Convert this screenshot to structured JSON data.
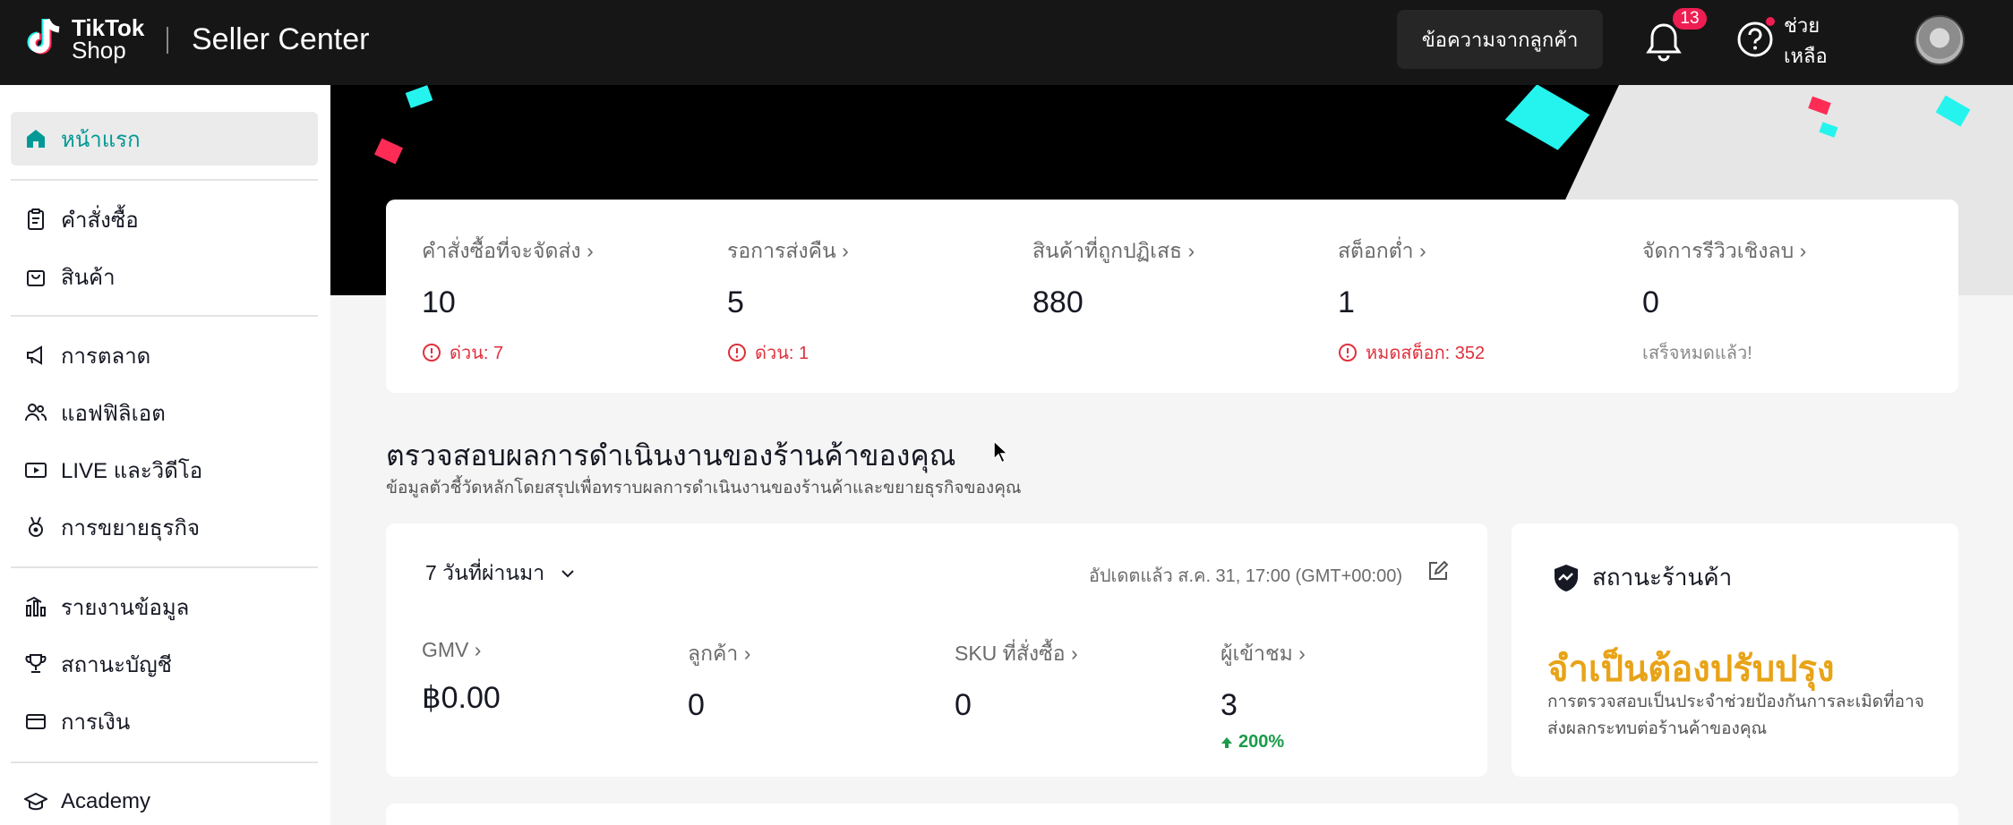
{
  "topbar": {
    "logo_text_1": "TikTok",
    "logo_text_2": "Shop",
    "title": "Seller Center",
    "messages_button": "ข้อความจากลูกค้า",
    "notification_count": "13",
    "help_label": "ช่วยเหลือ"
  },
  "sidebar": {
    "items": [
      {
        "label": "หน้าแรก",
        "icon": "home-icon",
        "active": true
      },
      {
        "label": "คำสั่งซื้อ",
        "icon": "clipboard-icon"
      },
      {
        "label": "สินค้า",
        "icon": "shopping-bag-icon"
      },
      {
        "label": "การตลาด",
        "icon": "megaphone-icon"
      },
      {
        "label": "แอฟฟิลิเอต",
        "icon": "users-icon"
      },
      {
        "label": "LIVE และวิดีโอ",
        "icon": "video-icon"
      },
      {
        "label": "การขยายธุรกิจ",
        "icon": "medal-icon"
      },
      {
        "label": "รายงานข้อมูล",
        "icon": "bar-chart-icon"
      },
      {
        "label": "สถานะบัญชี",
        "icon": "trophy-icon"
      },
      {
        "label": "การเงิน",
        "icon": "wallet-icon"
      },
      {
        "label": "Academy",
        "icon": "graduation-cap-icon"
      }
    ]
  },
  "todo": {
    "items": [
      {
        "label": "คำสั่งซื้อที่จะจัดส่ง",
        "value": "10",
        "sub": "ด่วน: 7",
        "warn": true
      },
      {
        "label": "รอการส่งคืน",
        "value": "5",
        "sub": "ด่วน: 1",
        "warn": true
      },
      {
        "label": "สินค้าที่ถูกปฏิเสธ",
        "value": "880",
        "sub": "",
        "warn": false
      },
      {
        "label": "สต็อกต่ำ",
        "value": "1",
        "sub": "หมดสต็อก: 352",
        "warn": true
      },
      {
        "label": "จัดการรีวิวเชิงลบ",
        "value": "0",
        "sub": "เสร็จหมดแล้ว!",
        "warn": false
      }
    ]
  },
  "performance": {
    "title": "ตรวจสอบผลการดำเนินงานของร้านค้าของคุณ",
    "subtitle": "ข้อมูลตัวชี้วัดหลักโดยสรุปเพื่อทราบผลการดำเนินงานของร้านค้าและขยายธุรกิจของคุณ",
    "period": "7 วันที่ผ่านมา",
    "updated": "อัปเดตแล้ว ส.ค. 31, 17:00 (GMT+00:00)",
    "metrics": [
      {
        "label": "GMV",
        "value": "฿0.00",
        "change": ""
      },
      {
        "label": "ลูกค้า",
        "value": "0",
        "change": ""
      },
      {
        "label": "SKU ที่สั่งซื้อ",
        "value": "0",
        "change": ""
      },
      {
        "label": "ผู้เข้าชม",
        "value": "3",
        "change": "200%"
      }
    ]
  },
  "shop_status": {
    "title": "สถานะร้านค้า",
    "value": "จำเป็นต้องปรับปรุง",
    "description": "การตรวจสอบเป็นประจำช่วยป้องกันการละเมิดที่อาจส่งผลกระทบต่อร้านค้าของคุณ"
  },
  "colors": {
    "accent": "#009995",
    "warning": "#e0303c",
    "status": "#e8a317",
    "positive": "#1a9c49"
  }
}
